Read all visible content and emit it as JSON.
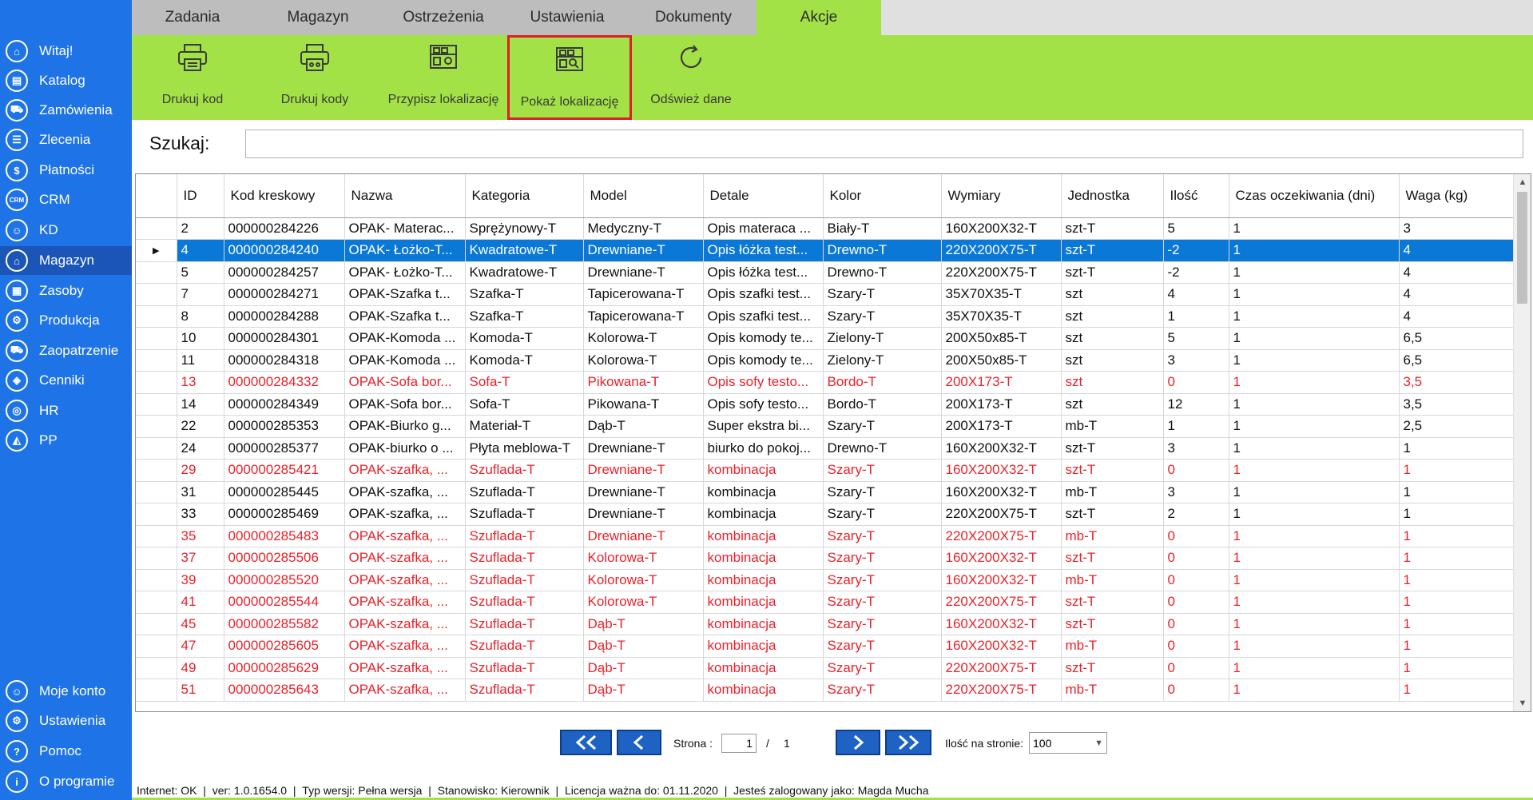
{
  "sidebar": {
    "items": [
      {
        "label": "Witaj!",
        "icon": "home-icon",
        "glyph": "⌂"
      },
      {
        "label": "Katalog",
        "icon": "book-icon",
        "glyph": "▤"
      },
      {
        "label": "Zamówienia",
        "icon": "cart-icon",
        "glyph": "⛟"
      },
      {
        "label": "Zlecenia",
        "icon": "list-icon",
        "glyph": "☰"
      },
      {
        "label": "Płatności",
        "icon": "dollar-icon",
        "glyph": "$"
      },
      {
        "label": "CRM",
        "icon": "crm-icon",
        "glyph": "CRM"
      },
      {
        "label": "KD",
        "icon": "person-icon",
        "glyph": "☺"
      },
      {
        "label": "Magazyn",
        "icon": "warehouse-icon",
        "glyph": "⌂"
      },
      {
        "label": "Zasoby",
        "icon": "resources-icon",
        "glyph": "▦"
      },
      {
        "label": "Produkcja",
        "icon": "production-icon",
        "glyph": "⚙"
      },
      {
        "label": "Zaopatrzenie",
        "icon": "truck-icon",
        "glyph": "⛟"
      },
      {
        "label": "Cenniki",
        "icon": "tag-icon",
        "glyph": "◈"
      },
      {
        "label": "HR",
        "icon": "hr-icon",
        "glyph": "◎"
      },
      {
        "label": "PP",
        "icon": "chart-icon",
        "glyph": "◭"
      }
    ],
    "bottom_items": [
      {
        "label": "Moje konto",
        "icon": "account-icon",
        "glyph": "☺"
      },
      {
        "label": "Ustawienia",
        "icon": "settings-icon",
        "glyph": "⚙"
      },
      {
        "label": "Pomoc",
        "icon": "help-icon",
        "glyph": "?"
      },
      {
        "label": "O programie",
        "icon": "info-icon",
        "glyph": "i"
      }
    ]
  },
  "tabs": [
    "Zadania",
    "Magazyn",
    "Ostrzeżenia",
    "Ustawienia",
    "Dokumenty",
    "Akcje"
  ],
  "toolbar": {
    "print_code": "Drukuj kod",
    "print_codes": "Drukuj kody",
    "assign_location": "Przypisz lokalizację",
    "show_location": "Pokaż lokalizację",
    "refresh": "Odśwież dane"
  },
  "search": {
    "label": "Szukaj:",
    "value": ""
  },
  "table": {
    "columns": [
      "ID",
      "Kod kreskowy",
      "Nazwa",
      "Kategoria",
      "Model",
      "Detale",
      "Kolor",
      "Wymiary",
      "Jednostka",
      "Ilość",
      "Czas oczekiwania (dni)",
      "Waga (kg)"
    ],
    "rows": [
      {
        "cells": [
          "2",
          "000000284226",
          "OPAK- Materac...",
          "Sprężynowy-T",
          "Medyczny-T",
          "Opis materaca ...",
          "Biały-T",
          "160X200X32-T",
          "szt-T",
          "5",
          "1",
          "3"
        ],
        "red": false,
        "selected": false
      },
      {
        "cells": [
          "4",
          "000000284240",
          "OPAK- Łożko-T...",
          "Kwadratowe-T",
          "Drewniane-T",
          "Opis łóżka test...",
          "Drewno-T",
          "220X200X75-T",
          "szt-T",
          "-2",
          "1",
          "4"
        ],
        "red": false,
        "selected": true
      },
      {
        "cells": [
          "5",
          "000000284257",
          "OPAK- Łożko-T...",
          "Kwadratowe-T",
          "Drewniane-T",
          "Opis łóżka test...",
          "Drewno-T",
          "220X200X75-T",
          "szt-T",
          "-2",
          "1",
          "4"
        ],
        "red": false,
        "selected": false
      },
      {
        "cells": [
          "7",
          "000000284271",
          "OPAK-Szafka t...",
          "Szafka-T",
          "Tapicerowana-T",
          "Opis szafki test...",
          "Szary-T",
          "35X70X35-T",
          "szt",
          "4",
          "1",
          "4"
        ],
        "red": false,
        "selected": false
      },
      {
        "cells": [
          "8",
          "000000284288",
          "OPAK-Szafka t...",
          "Szafka-T",
          "Tapicerowana-T",
          "Opis szafki test...",
          "Szary-T",
          "35X70X35-T",
          "szt",
          "1",
          "1",
          "4"
        ],
        "red": false,
        "selected": false
      },
      {
        "cells": [
          "10",
          "000000284301",
          "OPAK-Komoda ...",
          "Komoda-T",
          "Kolorowa-T",
          "Opis komody te...",
          "Zielony-T",
          "200X50x85-T",
          "szt",
          "5",
          "1",
          "6,5"
        ],
        "red": false,
        "selected": false
      },
      {
        "cells": [
          "11",
          "000000284318",
          "OPAK-Komoda ...",
          "Komoda-T",
          "Kolorowa-T",
          "Opis komody te...",
          "Zielony-T",
          "200X50x85-T",
          "szt",
          "3",
          "1",
          "6,5"
        ],
        "red": false,
        "selected": false
      },
      {
        "cells": [
          "13",
          "000000284332",
          "OPAK-Sofa bor...",
          "Sofa-T",
          "Pikowana-T",
          "Opis sofy testo...",
          "Bordo-T",
          "200X173-T",
          "szt",
          "0",
          "1",
          "3,5"
        ],
        "red": true,
        "selected": false
      },
      {
        "cells": [
          "14",
          "000000284349",
          "OPAK-Sofa bor...",
          "Sofa-T",
          "Pikowana-T",
          "Opis sofy testo...",
          "Bordo-T",
          "200X173-T",
          "szt",
          "12",
          "1",
          "3,5"
        ],
        "red": false,
        "selected": false
      },
      {
        "cells": [
          "22",
          "000000285353",
          "OPAK-Biurko g...",
          "Materiał-T",
          "Dąb-T",
          "Super ekstra bi...",
          "Szary-T",
          "200X173-T",
          "mb-T",
          "1",
          "1",
          "2,5"
        ],
        "red": false,
        "selected": false
      },
      {
        "cells": [
          "24",
          "000000285377",
          "OPAK-biurko o ...",
          "Płyta meblowa-T",
          "Drewniane-T",
          "biurko do pokoj...",
          "Drewno-T",
          "160X200X32-T",
          "szt-T",
          "3",
          "1",
          "1"
        ],
        "red": false,
        "selected": false
      },
      {
        "cells": [
          "29",
          "000000285421",
          "OPAK-szafka, ...",
          "Szuflada-T",
          "Drewniane-T",
          "kombinacja",
          "Szary-T",
          "160X200X32-T",
          "szt-T",
          "0",
          "1",
          "1"
        ],
        "red": true,
        "selected": false
      },
      {
        "cells": [
          "31",
          "000000285445",
          "OPAK-szafka, ...",
          "Szuflada-T",
          "Drewniane-T",
          "kombinacja",
          "Szary-T",
          "160X200X32-T",
          "mb-T",
          "3",
          "1",
          "1"
        ],
        "red": false,
        "selected": false
      },
      {
        "cells": [
          "33",
          "000000285469",
          "OPAK-szafka, ...",
          "Szuflada-T",
          "Drewniane-T",
          "kombinacja",
          "Szary-T",
          "220X200X75-T",
          "szt-T",
          "2",
          "1",
          "1"
        ],
        "red": false,
        "selected": false
      },
      {
        "cells": [
          "35",
          "000000285483",
          "OPAK-szafka, ...",
          "Szuflada-T",
          "Drewniane-T",
          "kombinacja",
          "Szary-T",
          "220X200X75-T",
          "mb-T",
          "0",
          "1",
          "1"
        ],
        "red": true,
        "selected": false
      },
      {
        "cells": [
          "37",
          "000000285506",
          "OPAK-szafka, ...",
          "Szuflada-T",
          "Kolorowa-T",
          "kombinacja",
          "Szary-T",
          "160X200X32-T",
          "szt-T",
          "0",
          "1",
          "1"
        ],
        "red": true,
        "selected": false
      },
      {
        "cells": [
          "39",
          "000000285520",
          "OPAK-szafka, ...",
          "Szuflada-T",
          "Kolorowa-T",
          "kombinacja",
          "Szary-T",
          "160X200X32-T",
          "mb-T",
          "0",
          "1",
          "1"
        ],
        "red": true,
        "selected": false
      },
      {
        "cells": [
          "41",
          "000000285544",
          "OPAK-szafka, ...",
          "Szuflada-T",
          "Kolorowa-T",
          "kombinacja",
          "Szary-T",
          "220X200X75-T",
          "szt-T",
          "0",
          "1",
          "1"
        ],
        "red": true,
        "selected": false
      },
      {
        "cells": [
          "45",
          "000000285582",
          "OPAK-szafka, ...",
          "Szuflada-T",
          "Dąb-T",
          "kombinacja",
          "Szary-T",
          "160X200X32-T",
          "szt-T",
          "0",
          "1",
          "1"
        ],
        "red": true,
        "selected": false
      },
      {
        "cells": [
          "47",
          "000000285605",
          "OPAK-szafka, ...",
          "Szuflada-T",
          "Dąb-T",
          "kombinacja",
          "Szary-T",
          "160X200X32-T",
          "mb-T",
          "0",
          "1",
          "1"
        ],
        "red": true,
        "selected": false
      },
      {
        "cells": [
          "49",
          "000000285629",
          "OPAK-szafka, ...",
          "Szuflada-T",
          "Dąb-T",
          "kombinacja",
          "Szary-T",
          "220X200X75-T",
          "szt-T",
          "0",
          "1",
          "1"
        ],
        "red": true,
        "selected": false
      },
      {
        "cells": [
          "51",
          "000000285643",
          "OPAK-szafka, ...",
          "Szuflada-T",
          "Dąb-T",
          "kombinacja",
          "Szary-T",
          "220X200X75-T",
          "mb-T",
          "0",
          "1",
          "1"
        ],
        "red": true,
        "selected": false
      }
    ]
  },
  "pager": {
    "page_label": "Strona :",
    "page_value": "1",
    "separator": "/",
    "total_pages": "1",
    "per_page_label": "Ilość na stronie:",
    "per_page_value": "100"
  },
  "status": {
    "internet": "Internet: OK",
    "version": "ver: 1.0.1654.0",
    "edition": "Typ wersji: Pełna wersja",
    "station": "Stanowisko: Kierownik",
    "license": "Licencja ważna do: 01.11.2020",
    "user": "Jesteś zalogowany jako: Magda Mucha"
  },
  "colors": {
    "sidebar": "#1e73e6",
    "accent_green": "#a3e246",
    "selected_row": "#0a78d6",
    "alert_red": "#e8222a"
  }
}
